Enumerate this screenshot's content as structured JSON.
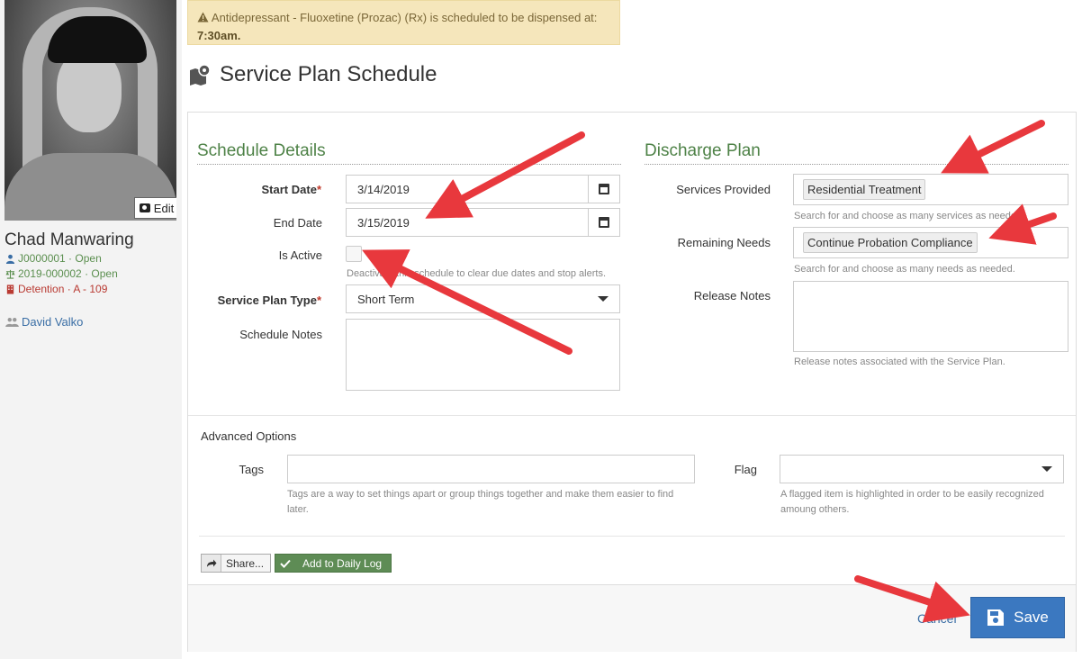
{
  "alert": {
    "prefix": "Antidepressant - Fluoxetine (Prozac) (Rx) is scheduled to be dispensed at:",
    "time": "7:30am."
  },
  "page": {
    "title": "Service Plan Schedule"
  },
  "sidebar": {
    "edit_label": "Edit",
    "name": "Chad Manwaring",
    "id_line": "J0000001 · Open",
    "case_line": "2019-000002 · Open",
    "location_line": "Detention · A - 109",
    "staff_name": "David Valko"
  },
  "schedule": {
    "heading": "Schedule Details",
    "start_date_label": "Start Date",
    "start_date_value": "3/14/2019",
    "end_date_label": "End Date",
    "end_date_value": "3/15/2019",
    "is_active_label": "Is Active",
    "is_active_help": "Deactivate this schedule to clear due dates and stop alerts.",
    "type_label": "Service Plan Type",
    "type_value": "Short Term",
    "notes_label": "Schedule Notes",
    "required_mark": "*"
  },
  "discharge": {
    "heading": "Discharge Plan",
    "services_label": "Services Provided",
    "services_chip": "Residential Treatment",
    "services_help": "Search for and choose as many services as needed.",
    "needs_label": "Remaining Needs",
    "needs_chip": "Continue Probation Compliance",
    "needs_help": "Search for and choose as many needs as needed.",
    "release_label": "Release Notes",
    "release_help": "Release notes associated with the Service Plan."
  },
  "advanced": {
    "heading": "Advanced Options",
    "tags_label": "Tags",
    "tags_help": "Tags are a way to set things apart or group things together and make them easier to find later.",
    "flag_label": "Flag",
    "flag_help": "A flagged item is highlighted in order to be easily recognized amoung others."
  },
  "actions": {
    "share_label": "Share...",
    "daily_log_label": "Add to Daily Log",
    "cancel_label": "Cancel",
    "save_label": "Save"
  },
  "colors": {
    "section_heading": "#4e8247",
    "alert_bg": "#f5e6bb",
    "save_button": "#3b78c0",
    "annotation_arrow": "#e8383d"
  }
}
